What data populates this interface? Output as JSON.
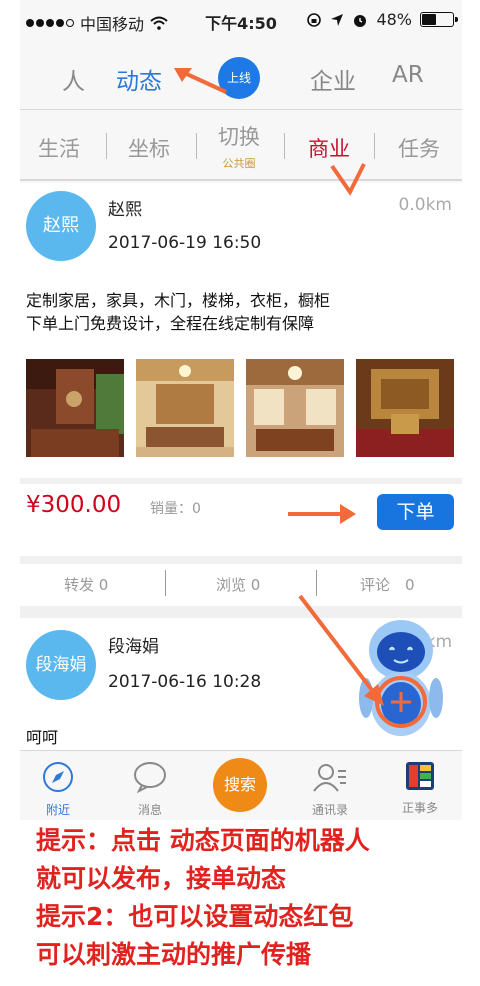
{
  "status_bar": {
    "carrier": "中国移动",
    "time": "下午4:50",
    "battery": "48%",
    "battery_level": 0.48
  },
  "top_tabs": {
    "people": "人",
    "dynamics": "动态",
    "online": "上线",
    "business": "企业",
    "ar": "AR"
  },
  "sub_tabs": {
    "life": "生活",
    "coordinate": "坐标",
    "switch": "切换",
    "switch_sub": "公共圈",
    "commerce": "商业",
    "task": "任务"
  },
  "posts": [
    {
      "avatar": "赵熙",
      "name": "赵熙",
      "time": "2017-06-19 16:50",
      "distance": "0.0km",
      "content_line1": "定制家居，家具，木门，楼梯，衣柜，橱柜",
      "content_line2": "下单上门免费设计，全程在线定制有保障",
      "price": "¥300.00",
      "sales": "销量：0",
      "order_button": "下单",
      "forward": "转发 0",
      "views": "浏览 0",
      "comments": "评论　0"
    },
    {
      "avatar": "段海娟",
      "name": "段海娟",
      "time": "2017-06-16 10:28",
      "distance": ".7km",
      "content": "呵呵"
    }
  ],
  "bottom_bar": {
    "nearby": "附近",
    "messages": "消息",
    "search": "搜索",
    "contacts": "通讯录",
    "zhengshiduo": "正事多"
  },
  "tips": [
    "提示：点击 动态页面的机器人",
    "就可以发布，接单动态",
    "提示2：也可以设置动态红包",
    "可以刺激主动的推广传播"
  ],
  "colors": {
    "accent_blue": "#2f77d9",
    "price_red": "#d0021b",
    "tip_red": "#e0231f",
    "search_orange": "#f08a17",
    "annotation_orange": "#f26a3a"
  }
}
